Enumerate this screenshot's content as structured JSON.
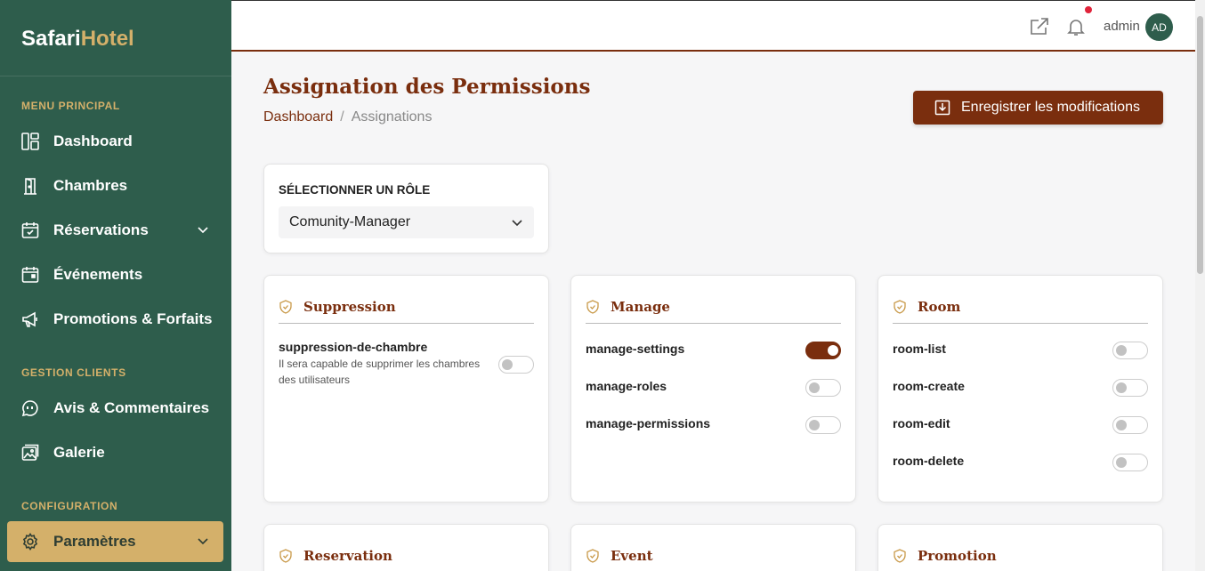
{
  "brand": {
    "part1": "Safari",
    "part2": "Hotel"
  },
  "sidebar": {
    "sections": [
      {
        "title": "MENU PRINCIPAL"
      },
      {
        "title": "GESTION CLIENTS"
      },
      {
        "title": "CONFIGURATION"
      }
    ],
    "items": [
      {
        "label": "Dashboard",
        "icon": "dashboard-icon"
      },
      {
        "label": "Chambres",
        "icon": "door-icon"
      },
      {
        "label": "Réservations",
        "icon": "calendar-check-icon",
        "has_submenu": true
      },
      {
        "label": "Événements",
        "icon": "calendar-icon"
      },
      {
        "label": "Promotions & Forfaits",
        "icon": "megaphone-icon"
      },
      {
        "label": "Avis & Commentaires",
        "icon": "chat-bubble-icon"
      },
      {
        "label": "Galerie",
        "icon": "gallery-icon"
      },
      {
        "label": "Paramètres",
        "icon": "gear-icon",
        "has_submenu": true,
        "active": true
      }
    ]
  },
  "topbar": {
    "admin_name": "admin",
    "avatar_initials": "AD",
    "has_notification": true
  },
  "header": {
    "title": "Assignation des Permissions",
    "breadcrumb": [
      "Dashboard",
      "Assignations"
    ],
    "breadcrumb_separator": "/",
    "save_label": "Enregistrer les modifications"
  },
  "role_selector": {
    "label": "SÉLECTIONNER UN RÔLE",
    "selected": "Comunity-Manager"
  },
  "permission_groups": [
    {
      "title": "Suppression",
      "permissions": [
        {
          "name": "suppression-de-chambre",
          "description": "Il sera capable de supprimer les chambres des utilisateurs",
          "enabled": false
        }
      ]
    },
    {
      "title": "Manage",
      "permissions": [
        {
          "name": "manage-settings",
          "enabled": true
        },
        {
          "name": "manage-roles",
          "enabled": false
        },
        {
          "name": "manage-permissions",
          "enabled": false
        }
      ]
    },
    {
      "title": "Room",
      "permissions": [
        {
          "name": "room-list",
          "enabled": false
        },
        {
          "name": "room-create",
          "enabled": false
        },
        {
          "name": "room-edit",
          "enabled": false
        },
        {
          "name": "room-delete",
          "enabled": false
        }
      ]
    },
    {
      "title": "Reservation",
      "permissions": []
    },
    {
      "title": "Event",
      "permissions": []
    },
    {
      "title": "Promotion",
      "permissions": []
    }
  ],
  "colors": {
    "sidebar_bg": "#2e5d4c",
    "accent_gold": "#d4b06a",
    "primary_brown": "#7a2e0e",
    "notification_red": "#e0233a"
  }
}
